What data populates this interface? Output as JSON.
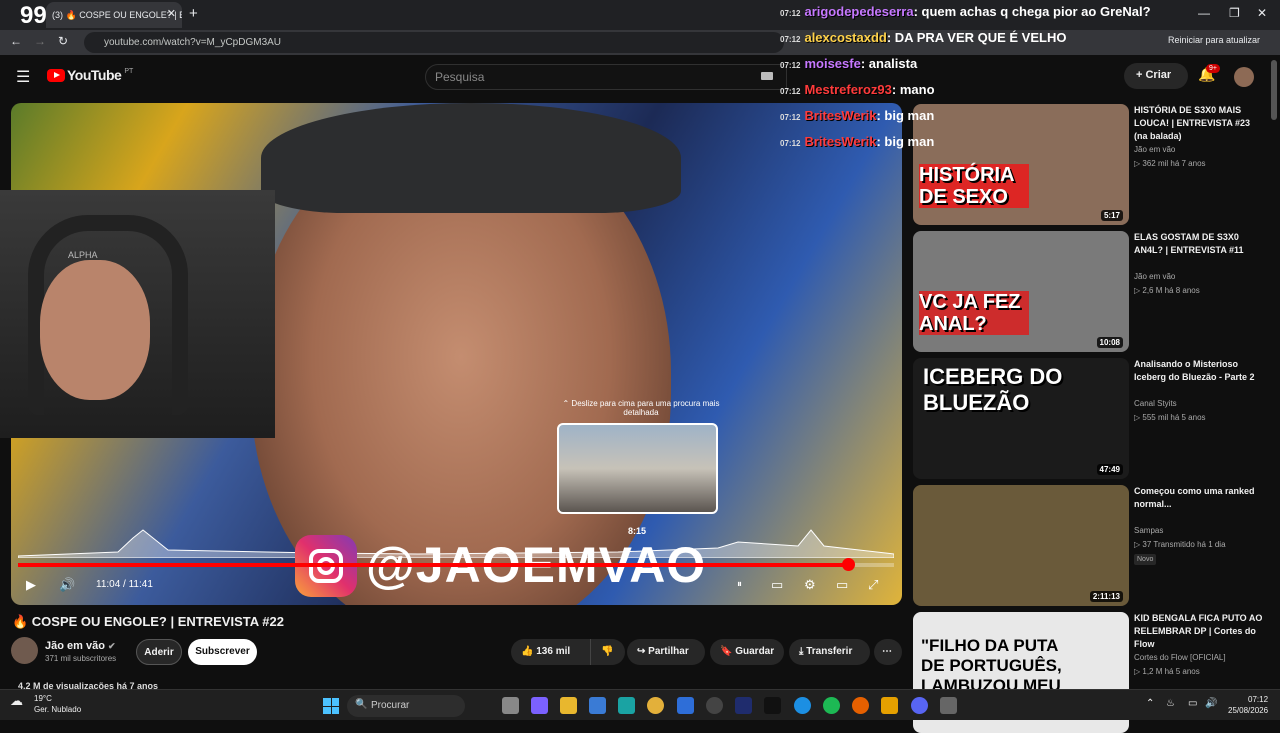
{
  "browser": {
    "tab_count": "99",
    "tab_title": "(3) 🔥 COSPE OU ENGOLE? | E",
    "url": "youtube.com/watch?v=M_yCpDGM3AU",
    "restart_label": "Reiniciar para atualizar"
  },
  "youtube": {
    "logo_text": "YouTube",
    "country": "PT",
    "search_placeholder": "Pesquisa",
    "create_label": "Criar",
    "notif_count": "9+"
  },
  "player": {
    "hint": "⌃ Deslize para cima para uma procura mais detalhada",
    "preview_time": "8:15",
    "current_time": "11:04",
    "duration": "11:41",
    "time_display": "11:04 / 11:41",
    "progress_fraction": 0.947,
    "overlay_handle": "@JAOEMVAO",
    "webcam_chair_text": "ALPHA"
  },
  "video": {
    "title": "🔥 COSPE OU ENGOLE? | ENTREVISTA #22",
    "channel": "Jão em vão",
    "subscribers": "371 mil subscritores",
    "join_label": "Aderir",
    "subscribe_label": "Subscrever",
    "likes": "136 mil",
    "share_label": "Partilhar",
    "save_label": "Guardar",
    "download_label": "Transferir",
    "views_line": "4,2 M de visualizações  há 7 anos"
  },
  "recommendations": [
    {
      "title": "HISTÓRIA DE S3X0 MAIS LOUCA! | ENTREVISTA #23 (na balada)",
      "channel": "Jão em vão",
      "meta": "362 mil  há 7 anos",
      "duration": "5:17",
      "thumb_text": "HISTÓRIA DE SEXO",
      "color": "#8a6d5a"
    },
    {
      "title": "ELAS GOSTAM DE S3X0 AN4L? | ENTREVISTA #11",
      "channel": "Jão em vão",
      "meta": "2,6 M  há 8 anos",
      "duration": "10:08",
      "thumb_text": "VC JA FEZ ANAL?",
      "color": "#7a7a7a"
    },
    {
      "title": "Analisando o Misterioso Iceberg do Bluezão - Parte 2",
      "channel": "Canal Styits",
      "meta": "555 mil  há 5 anos",
      "duration": "47:49",
      "thumb_text": "ICEBERG DO BLUEZÃO",
      "color": "#1b1b1b"
    },
    {
      "title": "Começou como uma ranked normal...",
      "channel": "Sampas",
      "meta": "37  Transmitido há 1 dia",
      "badge": "Novo",
      "duration": "2:11:13",
      "thumb_text": "",
      "color": "#6a5a3a"
    },
    {
      "title": "KID BENGALA FICA PUTO AO RELEMBRAR DP | Cortes do Flow",
      "channel": "Cortes do Flow [OFICIAL]",
      "meta": "1,2 M  há 5 anos",
      "duration": "",
      "thumb_text": "\"FILHO DA PUTA DE PORTUGUÊS, LAMBUZOU MEU",
      "color": "#e8e8e8"
    }
  ],
  "chat": [
    {
      "time": "07:12",
      "user": "arigodepedeserra",
      "msg": ": quem achas q chega pior ao GreNal?",
      "color": "#c678ff"
    },
    {
      "time": "07:12",
      "user": "alexcostaxdd",
      "msg": ": DA PRA VER QUE É VELHO",
      "color": "#ffd24a"
    },
    {
      "time": "07:12",
      "user": "moisesfe",
      "msg": ": analista",
      "color": "#c678ff"
    },
    {
      "time": "07:12",
      "user": "Mestreferoz93",
      "msg": ": mano",
      "color": "#ff3b3b"
    },
    {
      "time": "07:12",
      "user": "BritesWerik",
      "msg": ": big man",
      "color": "#ff3b3b"
    },
    {
      "time": "07:12",
      "user": "BritesWerik",
      "msg": ": big man",
      "color": "#ff3b3b"
    }
  ],
  "taskbar": {
    "temp": "19°C",
    "weather": "Ger. Nublado",
    "search": "Procurar",
    "time": "07:12",
    "date": "25/08/2026"
  }
}
